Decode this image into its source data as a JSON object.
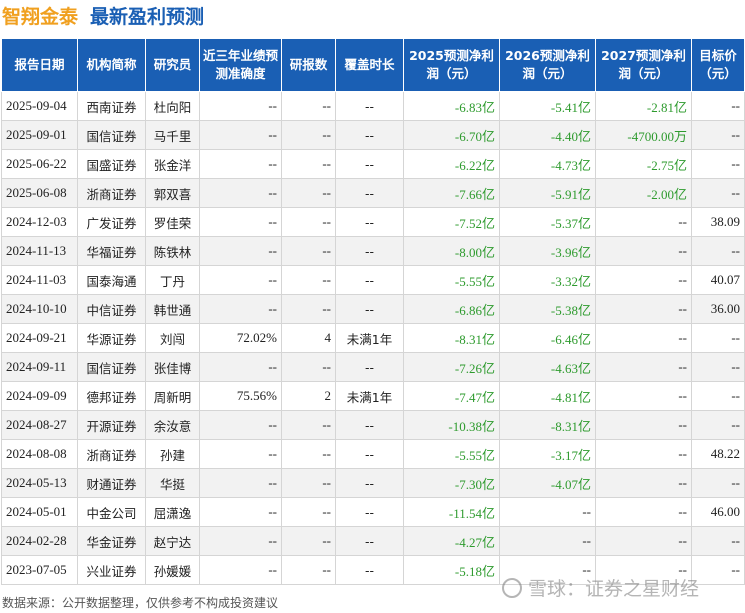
{
  "title": {
    "stock": "智翔金泰",
    "subtitle": "最新盈利预测"
  },
  "columns": [
    "报告日期",
    "机构简称",
    "研究员",
    "近三年业绩预测准确度",
    "研报数",
    "覆盖时长",
    "2025预测净利润（元）",
    "2026预测净利润（元）",
    "2027预测净利润（元）",
    "目标价（元）"
  ],
  "rows": [
    [
      "2025-09-04",
      "西南证券",
      "杜向阳",
      "--",
      "--",
      "--",
      "-6.83亿",
      "-5.41亿",
      "-2.81亿",
      "--"
    ],
    [
      "2025-09-01",
      "国信证券",
      "马千里",
      "--",
      "--",
      "--",
      "-6.70亿",
      "-4.40亿",
      "-4700.00万",
      "--"
    ],
    [
      "2025-06-22",
      "国盛证券",
      "张金洋",
      "--",
      "--",
      "--",
      "-6.22亿",
      "-4.73亿",
      "-2.75亿",
      "--"
    ],
    [
      "2025-06-08",
      "浙商证券",
      "郭双喜",
      "--",
      "--",
      "--",
      "-7.66亿",
      "-5.91亿",
      "-2.00亿",
      "--"
    ],
    [
      "2024-12-03",
      "广发证券",
      "罗佳荣",
      "--",
      "--",
      "--",
      "-7.52亿",
      "-5.37亿",
      "--",
      "38.09"
    ],
    [
      "2024-11-13",
      "华福证券",
      "陈铁林",
      "--",
      "--",
      "--",
      "-8.00亿",
      "-3.96亿",
      "--",
      "--"
    ],
    [
      "2024-11-03",
      "国泰海通",
      "丁丹",
      "--",
      "--",
      "--",
      "-5.55亿",
      "-3.32亿",
      "--",
      "40.07"
    ],
    [
      "2024-10-10",
      "中信证券",
      "韩世通",
      "--",
      "--",
      "--",
      "-6.86亿",
      "-5.38亿",
      "--",
      "36.00"
    ],
    [
      "2024-09-21",
      "华源证券",
      "刘闯",
      "72.02%",
      "4",
      "未满1年",
      "-8.31亿",
      "-6.46亿",
      "--",
      "--"
    ],
    [
      "2024-09-11",
      "国信证券",
      "张佳博",
      "--",
      "--",
      "--",
      "-7.26亿",
      "-4.63亿",
      "--",
      "--"
    ],
    [
      "2024-09-09",
      "德邦证券",
      "周新明",
      "75.56%",
      "2",
      "未满1年",
      "-7.47亿",
      "-4.81亿",
      "--",
      "--"
    ],
    [
      "2024-08-27",
      "开源证券",
      "余汝意",
      "--",
      "--",
      "--",
      "-10.38亿",
      "-8.31亿",
      "--",
      "--"
    ],
    [
      "2024-08-08",
      "浙商证券",
      "孙建",
      "--",
      "--",
      "--",
      "-5.55亿",
      "-3.17亿",
      "--",
      "48.22"
    ],
    [
      "2024-05-13",
      "财通证券",
      "华挺",
      "--",
      "--",
      "--",
      "-7.30亿",
      "-4.07亿",
      "--",
      "--"
    ],
    [
      "2024-05-01",
      "中金公司",
      "屈潇逸",
      "--",
      "--",
      "--",
      "-11.54亿",
      "--",
      "--",
      "46.00"
    ],
    [
      "2024-02-28",
      "华金证券",
      "赵宁达",
      "--",
      "--",
      "--",
      "-4.27亿",
      "--",
      "--",
      "--"
    ],
    [
      "2023-07-05",
      "兴业证券",
      "孙媛媛",
      "--",
      "--",
      "--",
      "-5.18亿",
      "--",
      "--",
      "--"
    ]
  ],
  "footer": "数据来源：公开数据整理，仅供参考不构成投资建议",
  "watermark": "雪球：证券之星财经",
  "colors": {
    "header_bg": "#1a5fb4",
    "negative": "#2e9b2e",
    "stock_title": "#f0a020"
  }
}
